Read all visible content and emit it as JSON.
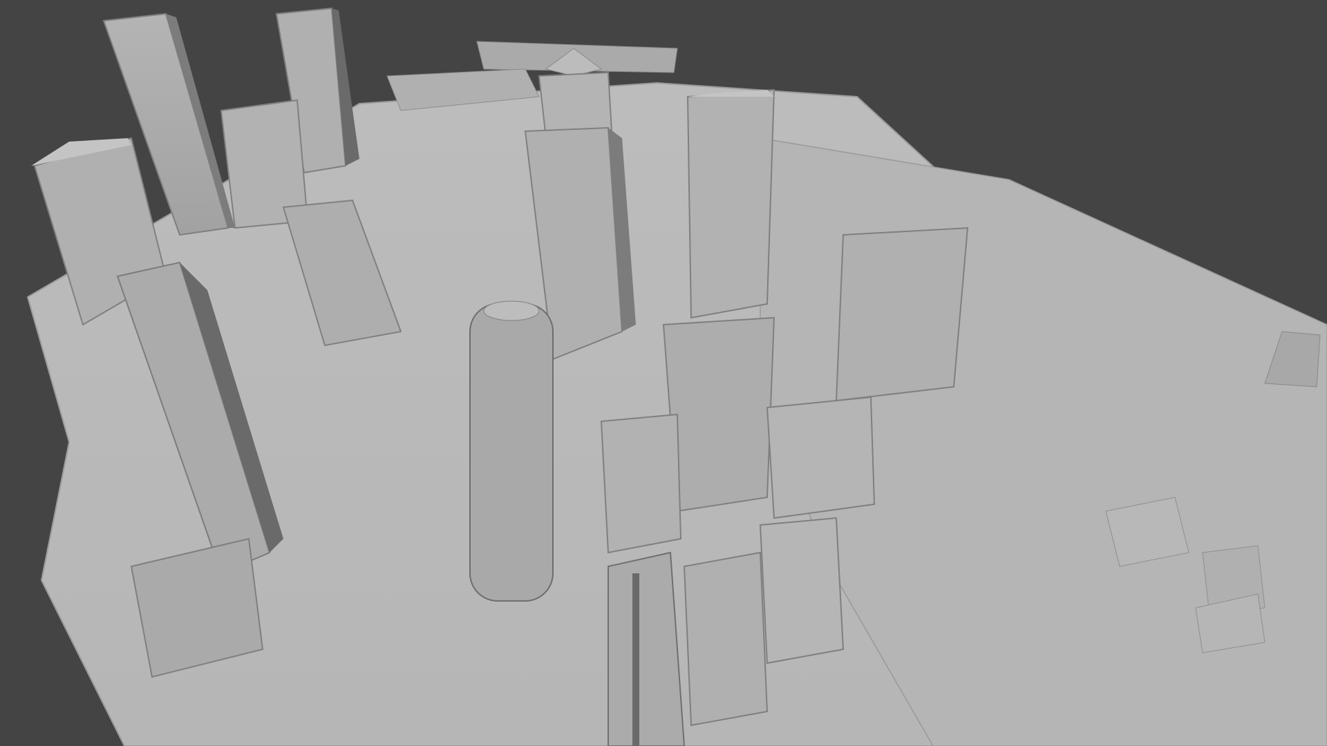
{
  "viewport": {
    "background_color": "#444444",
    "mesh_light": "#bdbdbd",
    "mesh_mid": "#a6a6a6",
    "mesh_dark": "#6e6e6e",
    "mesh_edge": "#7a7a7a",
    "render_mode": "solid-grey-clay"
  }
}
